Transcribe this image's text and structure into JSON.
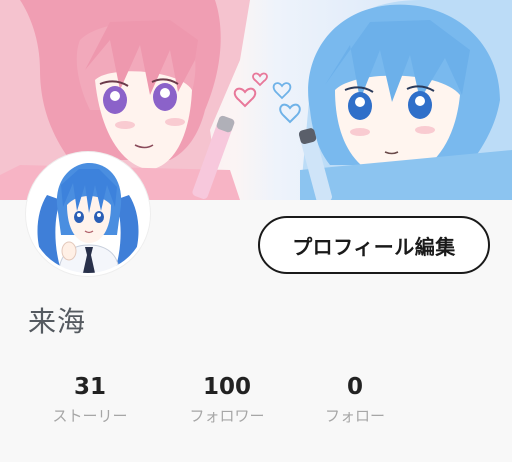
{
  "profile": {
    "username": "来海",
    "edit_label": "プロフィール編集"
  },
  "stats": [
    {
      "value": "31",
      "label": "ストーリー"
    },
    {
      "value": "100",
      "label": "フォロワー"
    },
    {
      "value": "0",
      "label": "フォロー"
    }
  ],
  "colors": {
    "pink_hair": "#f0a3b6",
    "blue_hair": "#7dbdf0",
    "text_dark": "#222222",
    "text_muted": "#a6a6a6",
    "username_color": "#555a60",
    "button_border": "#1a1a1a"
  },
  "icons": {
    "cover": "cover-illustration",
    "avatar": "avatar-illustration"
  }
}
